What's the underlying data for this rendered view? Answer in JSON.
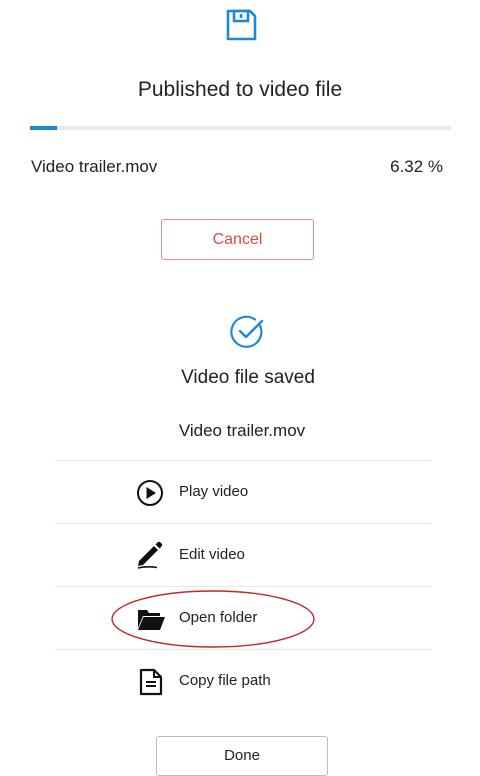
{
  "header": {
    "icon": "floppy-disk-icon",
    "title": "Published to video file"
  },
  "progress": {
    "filename": "Video trailer.mov",
    "percent_label": "6.32 %",
    "fraction": 0.0632,
    "fill_color": "#1a8ad4"
  },
  "cancel": {
    "label": "Cancel",
    "color": "#e04848"
  },
  "saved": {
    "icon": "check-circle-icon",
    "title": "Video file saved",
    "filename": "Video trailer.mov",
    "accent_color": "#1a8ad4"
  },
  "actions": [
    {
      "icon": "play-circle-icon",
      "label": "Play video"
    },
    {
      "icon": "pencil-icon",
      "label": "Edit video"
    },
    {
      "icon": "folder-icon",
      "label": "Open folder"
    },
    {
      "icon": "document-icon",
      "label": "Copy file path"
    }
  ],
  "highlight": {
    "target": "Open folder",
    "color": "#c0282d"
  },
  "done": {
    "label": "Done"
  }
}
